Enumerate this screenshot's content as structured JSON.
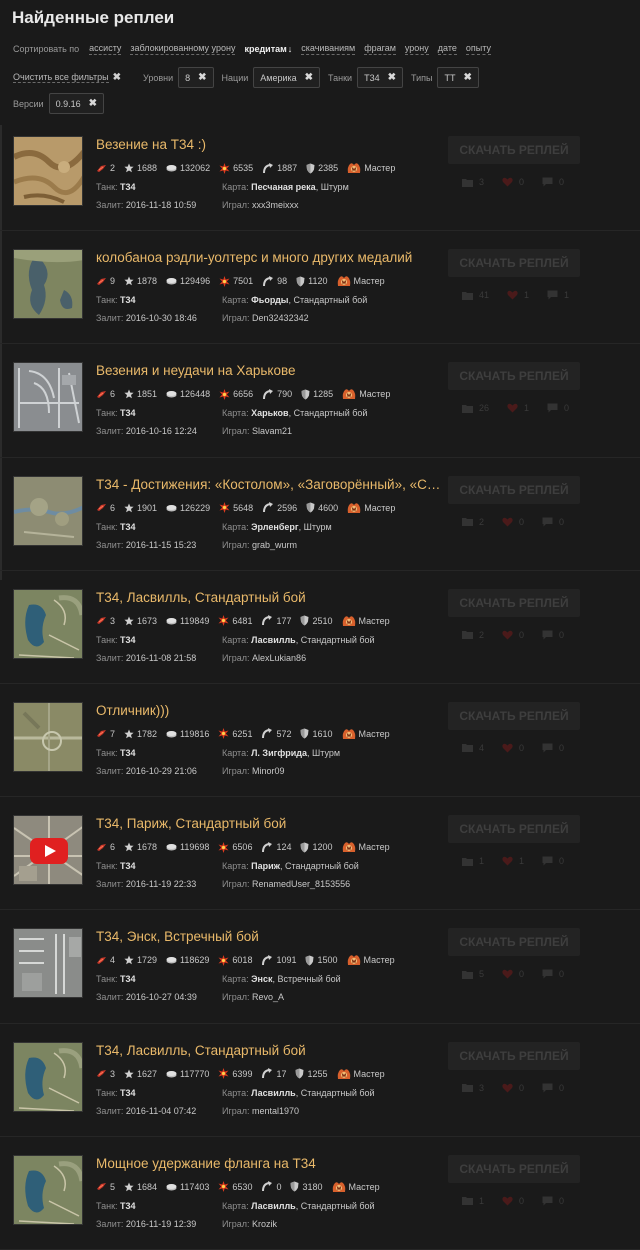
{
  "page_title": "Найденные реплеи",
  "sort": {
    "label": "Сортировать по",
    "options": [
      {
        "label": "ассисту",
        "active": false
      },
      {
        "label": "заблокированному урону",
        "active": false
      },
      {
        "label": "кредитам",
        "active": true,
        "arrow": "↓"
      },
      {
        "label": "скачиваниям",
        "active": false
      },
      {
        "label": "фрагам",
        "active": false
      },
      {
        "label": "урону",
        "active": false
      },
      {
        "label": "дате",
        "active": false
      },
      {
        "label": "опыту",
        "active": false
      }
    ]
  },
  "filters": {
    "clear_all": "Очистить все фильтры",
    "groups": [
      {
        "label": "Уровни",
        "chip": "8"
      },
      {
        "label": "Нации",
        "chip": "Америка"
      },
      {
        "label": "Танки",
        "chip": "Т34"
      },
      {
        "label": "Типы",
        "chip": "ТТ"
      }
    ],
    "version": {
      "label": "Версии",
      "chip": "0.9.16"
    }
  },
  "labels": {
    "tank": "Танк:",
    "map": "Карта:",
    "uploaded": "Залит:",
    "played": "Играл:",
    "download": "СКАЧАТЬ РЕПЛЕЙ"
  },
  "colors": {
    "accent_title": "#e9b96a",
    "background": "#1a1a1a"
  },
  "replays": [
    {
      "title": "Везение на Т34 :)",
      "kills": "2",
      "xp": "1688",
      "credits": "132062",
      "damage": "6535",
      "assist": "1887",
      "blocked": "2385",
      "mastery": "Мастер",
      "tank": "Т34",
      "map_name": "Песчаная река",
      "mode": ", Штурм",
      "uploaded": "2016-11-18 10:59",
      "player": "xxx3meixxx",
      "c1": "3",
      "c2": "0",
      "c3": "0",
      "thumb": "desert",
      "video": false
    },
    {
      "title": "колобаноа рэдли-уолтерс и много других медалий",
      "kills": "9",
      "xp": "1878",
      "credits": "129496",
      "damage": "7501",
      "assist": "98",
      "blocked": "1120",
      "mastery": "Мастер",
      "tank": "Т34",
      "map_name": "Фьорды",
      "mode": ", Стандартный бой",
      "uploaded": "2016-10-30 18:46",
      "player": "Den32432342",
      "c1": "41",
      "c2": "1",
      "c3": "1",
      "thumb": "fjord",
      "video": false
    },
    {
      "title": "Везения и неудачи на Харькове",
      "kills": "6",
      "xp": "1851",
      "credits": "126448",
      "damage": "6656",
      "assist": "790",
      "blocked": "1285",
      "mastery": "Мастер",
      "tank": "Т34",
      "map_name": "Харьков",
      "mode": ", Стандартный бой",
      "uploaded": "2016-10-16 12:24",
      "player": "Slavam21",
      "c1": "26",
      "c2": "1",
      "c3": "0",
      "thumb": "city",
      "video": false
    },
    {
      "title": "Т34 - Достижения: «Костолом», «Заговорённый», «С…",
      "kills": "6",
      "xp": "1901",
      "credits": "126229",
      "damage": "5648",
      "assist": "2596",
      "blocked": "4600",
      "mastery": "Мастер",
      "tank": "Т34",
      "map_name": "Эрленберг",
      "mode": ", Штурм",
      "uploaded": "2016-11-15 15:23",
      "player": "grab_wurm",
      "c1": "2",
      "c2": "0",
      "c3": "0",
      "thumb": "erlen",
      "video": false
    },
    {
      "title": "Т34, Ласвилль, Стандартный бой",
      "kills": "3",
      "xp": "1673",
      "credits": "119849",
      "damage": "6481",
      "assist": "177",
      "blocked": "2510",
      "mastery": "Мастер",
      "tank": "Т34",
      "map_name": "Ласвилль",
      "mode": ", Стандартный бой",
      "uploaded": "2016-11-08 21:58",
      "player": "AlexLukian86",
      "c1": "2",
      "c2": "0",
      "c3": "0",
      "thumb": "lake",
      "video": false
    },
    {
      "title": "Отличник)))",
      "kills": "7",
      "xp": "1782",
      "credits": "119816",
      "damage": "6251",
      "assist": "572",
      "blocked": "1610",
      "mastery": "Мастер",
      "tank": "Т34",
      "map_name": "Л. Зигфрида",
      "mode": ", Штурм",
      "uploaded": "2016-10-29 21:06",
      "player": "Minor09",
      "c1": "4",
      "c2": "0",
      "c3": "0",
      "thumb": "siegfried",
      "video": false
    },
    {
      "title": "Т34, Париж, Стандартный бой",
      "kills": "6",
      "xp": "1678",
      "credits": "119698",
      "damage": "6506",
      "assist": "124",
      "blocked": "1200",
      "mastery": "Мастер",
      "tank": "Т34",
      "map_name": "Париж",
      "mode": ", Стандартный бой",
      "uploaded": "2016-11-19 22:33",
      "player": "RenamedUser_8153556",
      "c1": "1",
      "c2": "1",
      "c3": "0",
      "thumb": "paris",
      "video": true
    },
    {
      "title": "Т34, Энск, Встречный бой",
      "kills": "4",
      "xp": "1729",
      "credits": "118629",
      "damage": "6018",
      "assist": "1091",
      "blocked": "1500",
      "mastery": "Мастер",
      "tank": "Т34",
      "map_name": "Энск",
      "mode": ", Встречный бой",
      "uploaded": "2016-10-27 04:39",
      "player": "Revo_A",
      "c1": "5",
      "c2": "0",
      "c3": "0",
      "thumb": "ensk",
      "video": false
    },
    {
      "title": "Т34, Ласвилль, Стандартный бой",
      "kills": "3",
      "xp": "1627",
      "credits": "117770",
      "damage": "6399",
      "assist": "17",
      "blocked": "1255",
      "mastery": "Мастер",
      "tank": "Т34",
      "map_name": "Ласвилль",
      "mode": ", Стандартный бой",
      "uploaded": "2016-11-04 07:42",
      "player": "mental1970",
      "c1": "3",
      "c2": "0",
      "c3": "0",
      "thumb": "lake",
      "video": false
    },
    {
      "title": "Мощное удержание фланга на Т34",
      "kills": "5",
      "xp": "1684",
      "credits": "117403",
      "damage": "6530",
      "assist": "0",
      "blocked": "3180",
      "mastery": "Мастер",
      "tank": "Т34",
      "map_name": "Ласвилль",
      "mode": ", Стандартный бой",
      "uploaded": "2016-11-19 12:39",
      "player": "Krozik",
      "c1": "1",
      "c2": "0",
      "c3": "0",
      "thumb": "lake",
      "video": false
    }
  ]
}
